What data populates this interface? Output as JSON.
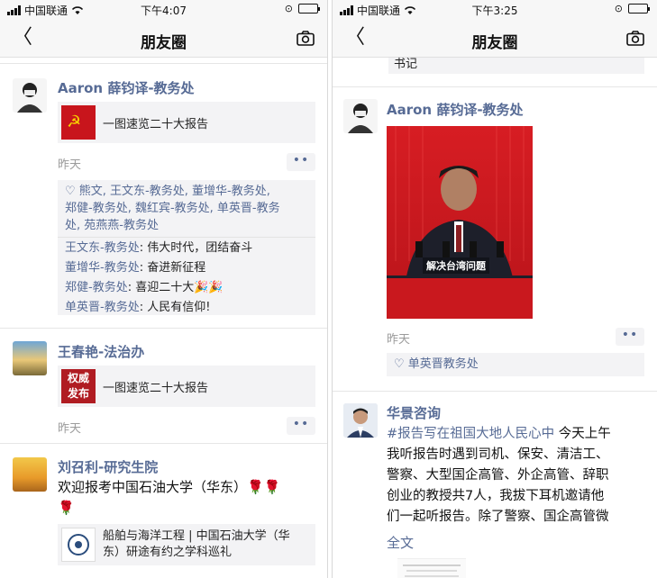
{
  "left": {
    "status": {
      "carrier": "中国联通",
      "time": "下午4:07"
    },
    "nav": {
      "title": "朋友圈"
    },
    "post1": {
      "name": "Aaron 薛钧译-教务处",
      "share_text": "一图速览二十大报告",
      "time": "昨天",
      "likes_line1": "♡ 熊文, 王文东-教务处, 董增华-教务处,",
      "likes_line2": "郑健-教务处, 魏红宾-教务处, 单英晋-教务",
      "likes_line3": "处, 苑燕燕-教务处",
      "comments": [
        {
          "who": "王文东-教务处",
          "text": ": 伟大时代，团结奋斗"
        },
        {
          "who": "董增华-教务处",
          "text": ": 奋进新征程"
        },
        {
          "who": "郑健-教务处",
          "text": ": 喜迎二十大🎉🎉"
        },
        {
          "who": "单英晋-教务处",
          "text": ": 人民有信仰!"
        }
      ]
    },
    "post2": {
      "name": "王春艳-法治办",
      "badge_line1": "权威",
      "badge_line2": "发布",
      "share_text": "一图速览二十大报告",
      "time": "昨天"
    },
    "post3": {
      "name": "刘召利-研究生院",
      "text": "欢迎报考中国石油大学（华东）🌹🌹",
      "text2": "🌹",
      "share_line1": "船舶与海洋工程 | 中国石油大学（华",
      "share_line2": "东）研途有约之学科巡礼"
    }
  },
  "right": {
    "status": {
      "carrier": "中国联通",
      "time": "下午3:25"
    },
    "nav": {
      "title": "朋友圈"
    },
    "top_snippet": "书记",
    "post1": {
      "name": "Aaron 薛钧译-教务处",
      "video_caption": "解决台湾问题",
      "time": "昨天",
      "likes": "♡ 单英晋教务处"
    },
    "post2": {
      "name": "华景咨询",
      "hashtag": "#报告写在祖国大地人民心中",
      "lines": [
        "今天上午",
        "我听报告时遇到司机、保安、清洁工、",
        "警察、大型国企高管、外企高管、辞职",
        "创业的教授共7人，我拔下耳机邀请他",
        "们一起听报告。除了警察、国企高管微"
      ],
      "full_text": "全文"
    }
  },
  "colors": {
    "link": "#576b95",
    "bg_box": "#f3f3f5",
    "flag_red": "#c8151c"
  }
}
